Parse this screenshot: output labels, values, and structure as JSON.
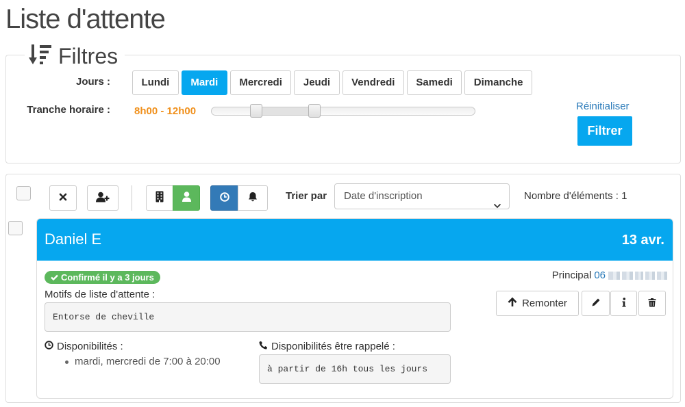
{
  "page": {
    "title": "Liste d'attente"
  },
  "filters": {
    "legend": "Filtres",
    "legend_icon": "sort-amount-desc-icon",
    "days_label": "Jours :",
    "days": [
      {
        "label": "Lundi",
        "active": false
      },
      {
        "label": "Mardi",
        "active": true
      },
      {
        "label": "Mercredi",
        "active": false
      },
      {
        "label": "Jeudi",
        "active": false
      },
      {
        "label": "Vendredi",
        "active": false
      },
      {
        "label": "Samedi",
        "active": false
      },
      {
        "label": "Dimanche",
        "active": false
      }
    ],
    "time_range_label": "Tranche horaire :",
    "time_range_value": "8h00 - 12h00",
    "time_range_slider": {
      "low_pct": 17,
      "high_pct": 39
    },
    "reset_label": "Réinitialiser",
    "submit_label": "Filtrer"
  },
  "toolbar": {
    "select_all_checked": false,
    "buttons": [
      {
        "icon": "close-icon",
        "active": false
      },
      {
        "icon": "user-plus-icon",
        "active": false
      },
      {
        "icon": "building-icon",
        "active": false
      },
      {
        "icon": "user-icon",
        "active": true
      },
      {
        "icon": "clock-icon",
        "active": true
      },
      {
        "icon": "bell-icon",
        "active": false
      }
    ],
    "sort_label": "Trier par",
    "sort_value": "Date d'inscription",
    "count_label": "Nombre d'éléments :",
    "count": "1"
  },
  "entries": [
    {
      "name": "Daniel E",
      "date": "13 avr.",
      "status_icon": "check-icon",
      "status_badge": "Confirmé il y a 3 jours",
      "phone_label": "Principal",
      "phone_visible": "06",
      "reason_label": "Motifs de liste d'attente :",
      "reason": "Entorse de cheville",
      "actions": {
        "move_up_label": "Remonter",
        "icons": [
          "arrow-up-icon",
          "pencil-icon",
          "info-icon",
          "trash-icon"
        ]
      },
      "availability_label": "Disponibilités :",
      "availability_icon": "clock-outline-icon",
      "availability": [
        "mardi, mercredi de 7:00 à 20:00"
      ],
      "callback_label": "Disponibilités être rappelé :",
      "callback_icon": "phone-icon",
      "callback": "à partir de 16h tous les jours"
    }
  ],
  "colors": {
    "accent": "#06a7ef",
    "primary": "#337ab7",
    "success": "#5cb85c",
    "time_range": "#f0901c",
    "link": "#2a7ab9"
  }
}
